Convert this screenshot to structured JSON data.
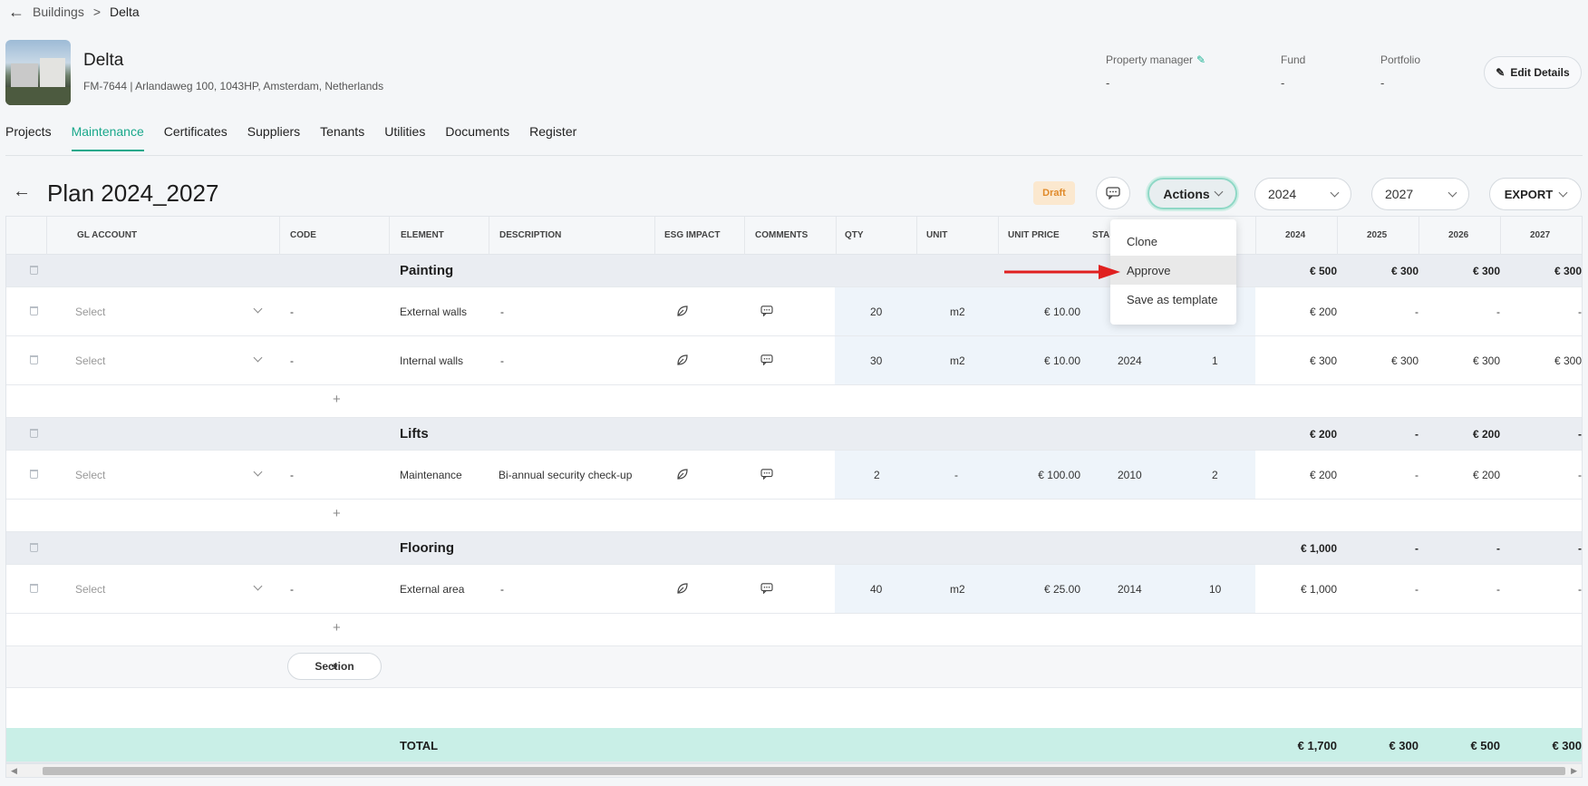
{
  "breadcrumb": {
    "parent": "Buildings",
    "separator": ">",
    "current": "Delta"
  },
  "building": {
    "name": "Delta",
    "address": "FM-7644 | Arlandaweg 100, 1043HP, Amsterdam, Netherlands",
    "meta": [
      {
        "label": "Property manager",
        "value": "-"
      },
      {
        "label": "Fund",
        "value": "-"
      },
      {
        "label": "Portfolio",
        "value": "-"
      }
    ],
    "edit_label": "Edit Details"
  },
  "tabs": [
    "Projects",
    "Maintenance",
    "Certificates",
    "Suppliers",
    "Tenants",
    "Utilities",
    "Documents",
    "Register"
  ],
  "active_tab": "Maintenance",
  "plan": {
    "title": "Plan 2024_2027",
    "status": "Draft",
    "actions_label": "Actions",
    "year_from": "2024",
    "year_to": "2027",
    "export_label": "EXPORT"
  },
  "actions_menu": [
    "Clone",
    "Approve",
    "Save as template"
  ],
  "highlighted_action": "Approve",
  "table": {
    "columns": [
      "GL ACCOUNT",
      "CODE",
      "ELEMENT",
      "DESCRIPTION",
      "ESG IMPACT",
      "COMMENTS",
      "QTY",
      "UNIT",
      "UNIT PRICE",
      "STA",
      "2024",
      "2025",
      "2026",
      "2027"
    ],
    "select_placeholder": "Select",
    "sections": [
      {
        "name": "Painting",
        "totals": [
          "€ 500",
          "€ 300",
          "€ 300",
          "€ 300"
        ],
        "rows": [
          {
            "code": "-",
            "element": "External walls",
            "description": "-",
            "qty": "20",
            "unit": "m2",
            "unit_price": "€ 10.00",
            "start": "",
            "cycle": "",
            "years": [
              "€ 200",
              "-",
              "-",
              "-"
            ]
          },
          {
            "code": "-",
            "element": "Internal walls",
            "description": "-",
            "qty": "30",
            "unit": "m2",
            "unit_price": "€ 10.00",
            "start": "2024",
            "cycle": "1",
            "years": [
              "€ 300",
              "€ 300",
              "€ 300",
              "€ 300"
            ]
          }
        ]
      },
      {
        "name": "Lifts",
        "totals": [
          "€ 200",
          "-",
          "€ 200",
          "-"
        ],
        "rows": [
          {
            "code": "-",
            "element": "Maintenance",
            "description": "Bi-annual security check-up",
            "qty": "2",
            "unit": "-",
            "unit_price": "€ 100.00",
            "start": "2010",
            "cycle": "2",
            "years": [
              "€ 200",
              "-",
              "€ 200",
              "-"
            ]
          }
        ]
      },
      {
        "name": "Flooring",
        "totals": [
          "€ 1,000",
          "-",
          "-",
          "-"
        ],
        "rows": [
          {
            "code": "-",
            "element": "External area",
            "description": "-",
            "qty": "40",
            "unit": "m2",
            "unit_price": "€ 25.00",
            "start": "2014",
            "cycle": "10",
            "years": [
              "€ 1,000",
              "-",
              "-",
              "-"
            ]
          }
        ]
      }
    ],
    "add_row_symbol": "+",
    "add_section_label": "Section",
    "total": {
      "label": "TOTAL",
      "years": [
        "€ 1,700",
        "€ 300",
        "€ 500",
        "€ 300"
      ]
    }
  }
}
